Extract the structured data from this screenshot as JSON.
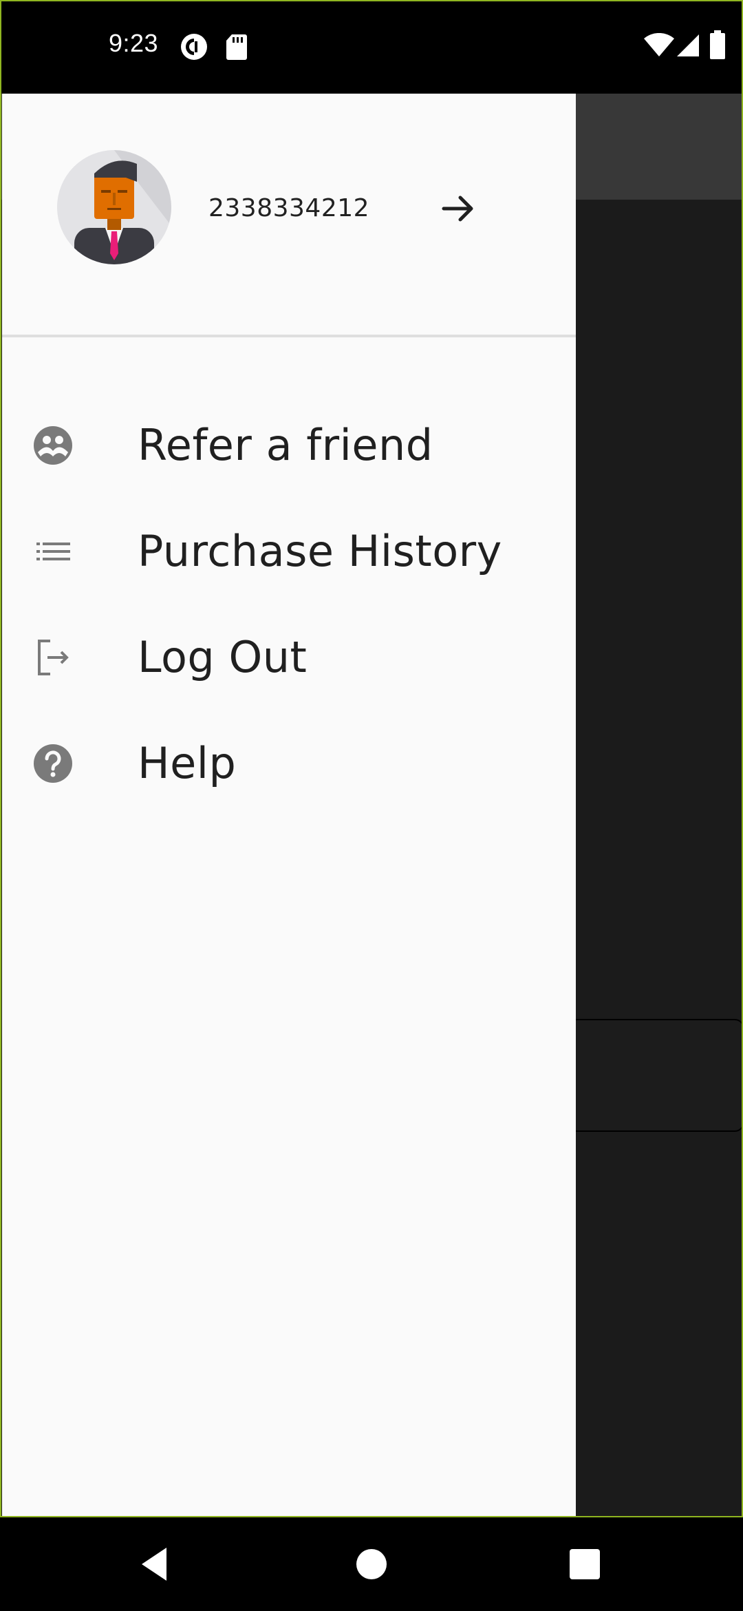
{
  "status_bar": {
    "time": "9:23",
    "icons_left": [
      "pocket-casts-icon",
      "sd-card-icon"
    ],
    "icons_right": [
      "wifi-icon",
      "cell-signal-icon",
      "battery-icon"
    ]
  },
  "drawer": {
    "account": {
      "avatar": "businessman-avatar",
      "phone": "2338334212",
      "action_icon": "arrow-right-icon"
    },
    "menu": [
      {
        "label": "Refer a friend",
        "icon": "group-icon"
      },
      {
        "label": "Purchase History",
        "icon": "list-icon"
      },
      {
        "label": "Log Out",
        "icon": "logout-icon"
      },
      {
        "label": "Help",
        "icon": "help-icon"
      }
    ]
  },
  "nav_bar": {
    "buttons": [
      "back-icon",
      "home-icon",
      "recents-icon"
    ]
  },
  "colors": {
    "drawer_bg": "#fafafa",
    "scrim": "#1b1b1b",
    "icon_gray": "#7a7a7a",
    "frame_accent": "#8fb520"
  }
}
